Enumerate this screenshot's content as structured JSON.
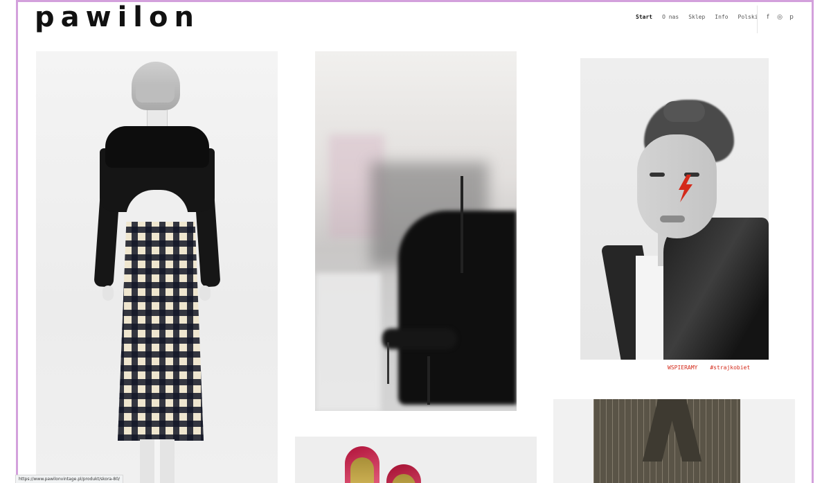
{
  "brand": {
    "logo": "pawilon"
  },
  "nav": {
    "items": [
      "Start",
      "O nas",
      "Sklep",
      "Info",
      "Polski"
    ],
    "active": "Start"
  },
  "social": [
    {
      "icon": "facebook-icon",
      "glyph": "f"
    },
    {
      "icon": "instagram-icon",
      "glyph": "◎"
    },
    {
      "icon": "pinterest-icon",
      "glyph": "p"
    }
  ],
  "gallery": {
    "caption": {
      "left": "WSPIERAMY",
      "right": "#strajkobiet"
    }
  },
  "status": {
    "url": "https://www.pawilonvintage.pl/produkt/skora-80/"
  },
  "colors": {
    "frame": "#d3a0dc",
    "caption": "#d42a1a",
    "text": "#111111"
  }
}
